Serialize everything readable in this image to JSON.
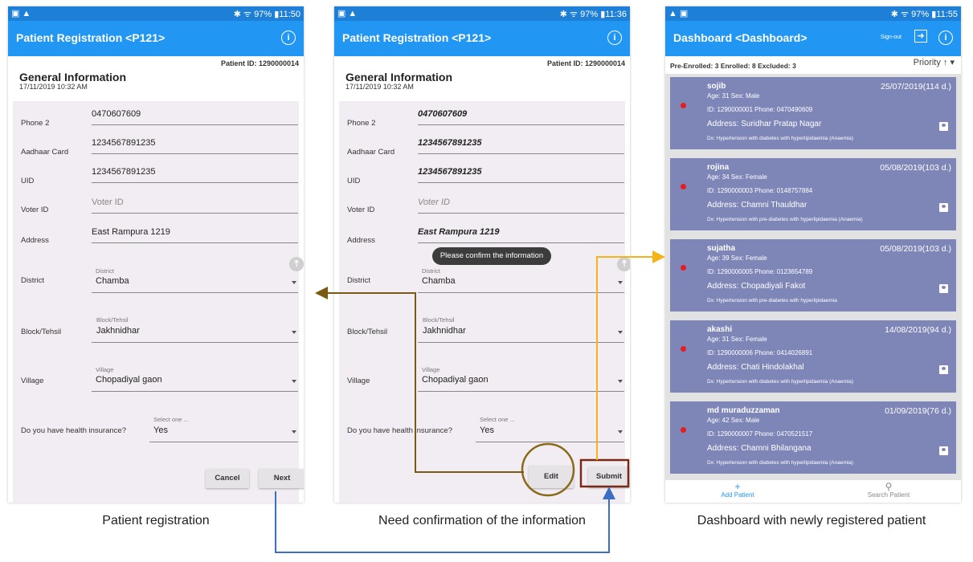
{
  "status": {
    "s1_right": "✱ ᯤ 97% ▮11:50",
    "s2_right": "✱ ᯤ 97% ▮11:36",
    "s3_right": "✱ ᯤ 97% ▮11:55"
  },
  "reg": {
    "title": "Patient Registration <P121>",
    "patient_id": "Patient ID: 1290000014",
    "section_title": "General Information",
    "section_date": "17/11/2019 10:32 AM",
    "fields": {
      "phone2": {
        "label": "Phone 2",
        "value": "0470607609"
      },
      "aadhaar": {
        "label": "Aadhaar Card",
        "value": "1234567891235"
      },
      "uid": {
        "label": "UID",
        "value": "1234567891235"
      },
      "voter": {
        "label": "Voter ID",
        "placeholder": "Voter ID"
      },
      "address": {
        "label": "Address",
        "value": "East Rampura 1219"
      },
      "district": {
        "label": "District",
        "caption": "District",
        "value": "Chamba"
      },
      "block": {
        "label": "Block/Tehsil",
        "caption": "Block/Tehsil",
        "value": "Jakhnidhar"
      },
      "village": {
        "label": "Village",
        "caption": "Village",
        "value": "Chopadiyal gaon"
      },
      "insurance": {
        "label": "Do you have health insurance?",
        "caption": "Select one ...",
        "value": "Yes"
      }
    },
    "cancel_label": "Cancel",
    "next_label": "Next",
    "edit_label": "Edit",
    "submit_label": "Submit",
    "toast": "Please confirm the information"
  },
  "dash": {
    "title": "Dashboard <Dashboard>",
    "signout": "Sign-out",
    "summary": "Pre-Enrolled: 3  Enrolled: 8  Excluded: 3",
    "priority": "Priority ↑ ▾",
    "cards": [
      {
        "name": "sojib",
        "date": "25/07/2019(114 d.)",
        "agesex": "Age: 31   Sex: Male",
        "idphone": "ID: 1290000001   Phone: 0470490609",
        "address": "Address: Suridhar Pratap Nagar",
        "dx": "Dx: Hypertension with diabetes with hyperlipidaemia (Anaemia)"
      },
      {
        "name": "rojina",
        "date": "05/08/2019(103 d.)",
        "agesex": "Age: 34   Sex: Female",
        "idphone": "ID: 1290000003   Phone: 0148757884",
        "address": "Address: Chamni Thauldhar",
        "dx": "Dx: Hypertension with pre-diabetes with hyperlipidaemia (Anaemia)"
      },
      {
        "name": "sujatha",
        "date": "05/08/2019(103 d.)",
        "agesex": "Age: 39   Sex: Female",
        "idphone": "ID: 1290000005   Phone: 0123654789",
        "address": "Address: Chopadiyali Fakot",
        "dx": "Dx: Hypertension with pre-diabetes with hyperlipidaemia"
      },
      {
        "name": "akashi",
        "date": "14/08/2019(94 d.)",
        "agesex": "Age: 31   Sex: Female",
        "idphone": "ID: 1290000006   Phone: 0414026891",
        "address": "Address: Chati Hindolakhal",
        "dx": "Dx: Hypertension with diabetes with hyperlipidaemia (Anaemia)"
      },
      {
        "name": "md muraduzzaman",
        "date": "01/09/2019(76 d.)",
        "agesex": "Age: 42   Sex: Male",
        "idphone": "ID: 1290000007   Phone: 0470521517",
        "address": "Address: Chamni Bhilangana",
        "dx": "Dx: Hypertension with diabetes with hyperlipidaemia (Anaemia)"
      }
    ],
    "add_patient": "Add Patient",
    "search_patient": "Search Patient"
  },
  "captions": {
    "c1": "Patient registration",
    "c2": "Need confirmation of the information",
    "c3": "Dashboard with newly registered patient"
  },
  "colors": {
    "appbar": "#2196f3",
    "statusbar": "#1e7fd6",
    "card": "#7e86b8",
    "form_bg": "#f2edf2",
    "arrow_brown": "#7a5a12",
    "arrow_gold": "#f2b418",
    "arrow_blue": "#3a6fc4"
  }
}
